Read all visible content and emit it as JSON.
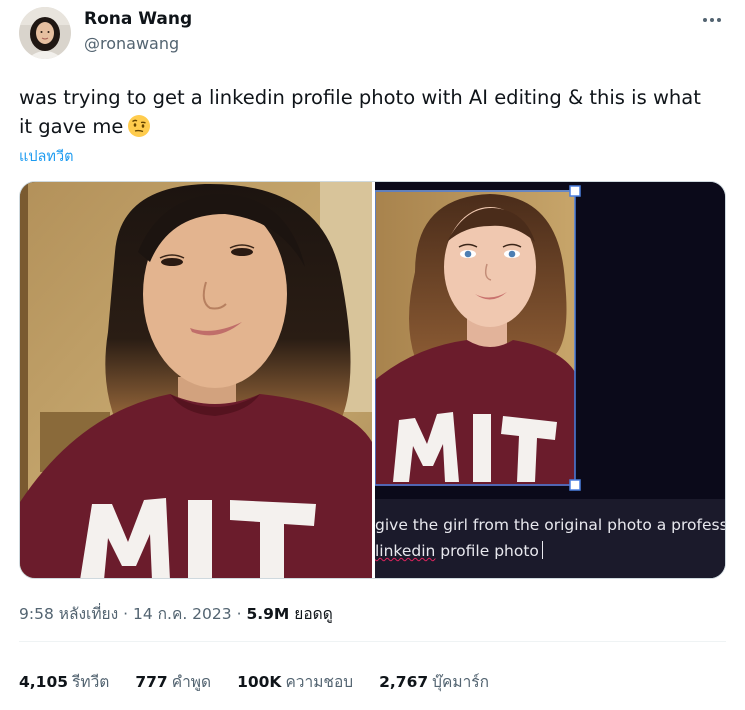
{
  "author": {
    "display_name": "Rona Wang",
    "handle": "@ronawang"
  },
  "tweet": {
    "text": "was trying to get a linkedin profile photo with AI editing & this is what it gave me",
    "emoji": "face-with-raised-eyebrow",
    "translate_label": "แปลทวีต"
  },
  "media": {
    "left_photo": "original-selfie",
    "right_photo": "ai-edited-photo",
    "prompt_line1": "give the girl from the original photo a professiona",
    "prompt_word": "linkedin",
    "prompt_line2_rest": " profile photo"
  },
  "meta": {
    "time": "9:58 หลังเที่ยง",
    "sep": "·",
    "date": "14 ก.ค. 2023",
    "views_count": "5.9M",
    "views_label": "ยอดดู"
  },
  "stats": [
    {
      "num": "4,105",
      "label": "รีทวีต"
    },
    {
      "num": "777",
      "label": "คำพูด"
    },
    {
      "num": "100K",
      "label": "ความชอบ"
    },
    {
      "num": "2,767",
      "label": "บุ๊คมาร์ก"
    }
  ],
  "colors": {
    "link": "#1d9bf0",
    "secondary": "#536471",
    "text": "#0f1419",
    "shirt": "#6b1c2c",
    "selection": "#4a7fe0"
  }
}
